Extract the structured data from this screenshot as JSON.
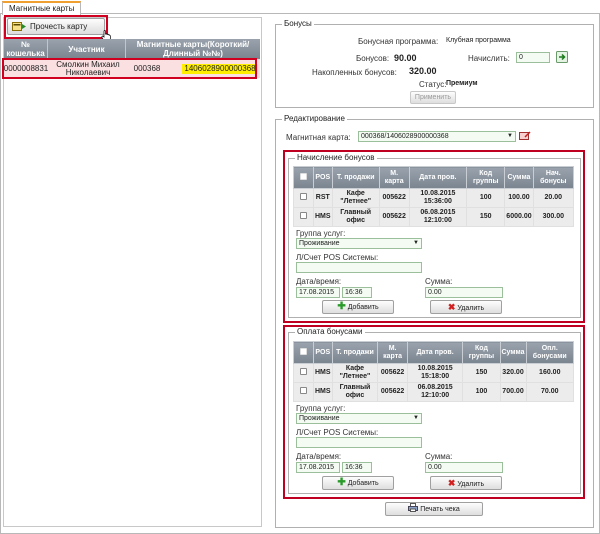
{
  "tab": "Магнитные карты",
  "left": {
    "read_button": "Прочесть карту",
    "columns": [
      "№ кошелька",
      "Участник",
      "Магнитные карты(Короткий/Длинный №№)"
    ],
    "row": {
      "wallet": "0000008831",
      "member": "Смолкин Михаил Николаевич",
      "short": "000368",
      "long": "1406028900000368"
    }
  },
  "bonuses": {
    "legend": "Бонусы",
    "program_label": "Бонусная программа:",
    "program_value": "Клубная программа",
    "bonuses_label": "Бонусов:",
    "bonuses_value": "90.00",
    "accrue_label": "Начислить:",
    "accrue_value": "0",
    "accumulated_label": "Накопленных бонусов:",
    "accumulated_value": "320.00",
    "status_label": "Статус:",
    "status_value": "Премиум",
    "apply_button": "Применить"
  },
  "editing": {
    "legend": "Редактирование",
    "card_label": "Магнитная карта:",
    "card_value": "000368/1406028900000368",
    "print_button": "Печать чека"
  },
  "accrual": {
    "legend": "Начисление бонусов",
    "headers": [
      "POS",
      "Т. продажи",
      "М. карта",
      "Дата пров.",
      "Код группы",
      "Сумма",
      "Нач. бонусы"
    ],
    "rows": [
      {
        "pos": "RST",
        "place": "Кафе \"Летнее\"",
        "card": "005622",
        "date": "10.08.2015 15:36:00",
        "code": "100",
        "sum": "100.00",
        "bonus": "20.00"
      },
      {
        "pos": "HMS",
        "place": "Главный офис",
        "card": "005622",
        "date": "06.08.2015 12:10:00",
        "code": "150",
        "sum": "6000.00",
        "bonus": "300.00"
      }
    ],
    "group_label": "Группа услуг:",
    "group_value": "Проживание",
    "account_label": "Л/Счет POS Системы:",
    "account_value": "",
    "datetime_label": "Дата/время:",
    "date_value": "17.08.2015",
    "time_value": "16:36",
    "sum_label": "Сумма:",
    "sum_value": "0.00",
    "add_button": "Добавить",
    "delete_button": "Удалить"
  },
  "payment": {
    "legend": "Оплата бонусами",
    "headers": [
      "POS",
      "Т. продажи",
      "М. карта",
      "Дата пров.",
      "Код группы",
      "Сумма",
      "Опл. бонусами"
    ],
    "rows": [
      {
        "pos": "HMS",
        "place": "Кафе \"Летнее\"",
        "card": "005622",
        "date": "10.08.2015 15:18:00",
        "code": "150",
        "sum": "320.00",
        "bonus": "160.00"
      },
      {
        "pos": "HMS",
        "place": "Главный офис",
        "card": "005622",
        "date": "06.08.2015 12:10:00",
        "code": "100",
        "sum": "700.00",
        "bonus": "70.00"
      }
    ],
    "group_label": "Группа услуг:",
    "group_value": "Проживание",
    "account_label": "Л/Счет POS Системы:",
    "account_value": "",
    "datetime_label": "Дата/время:",
    "date_value": "17.08.2015",
    "time_value": "16:36",
    "sum_label": "Сумма:",
    "sum_value": "0.00",
    "add_button": "Добавить",
    "delete_button": "Удалить"
  }
}
